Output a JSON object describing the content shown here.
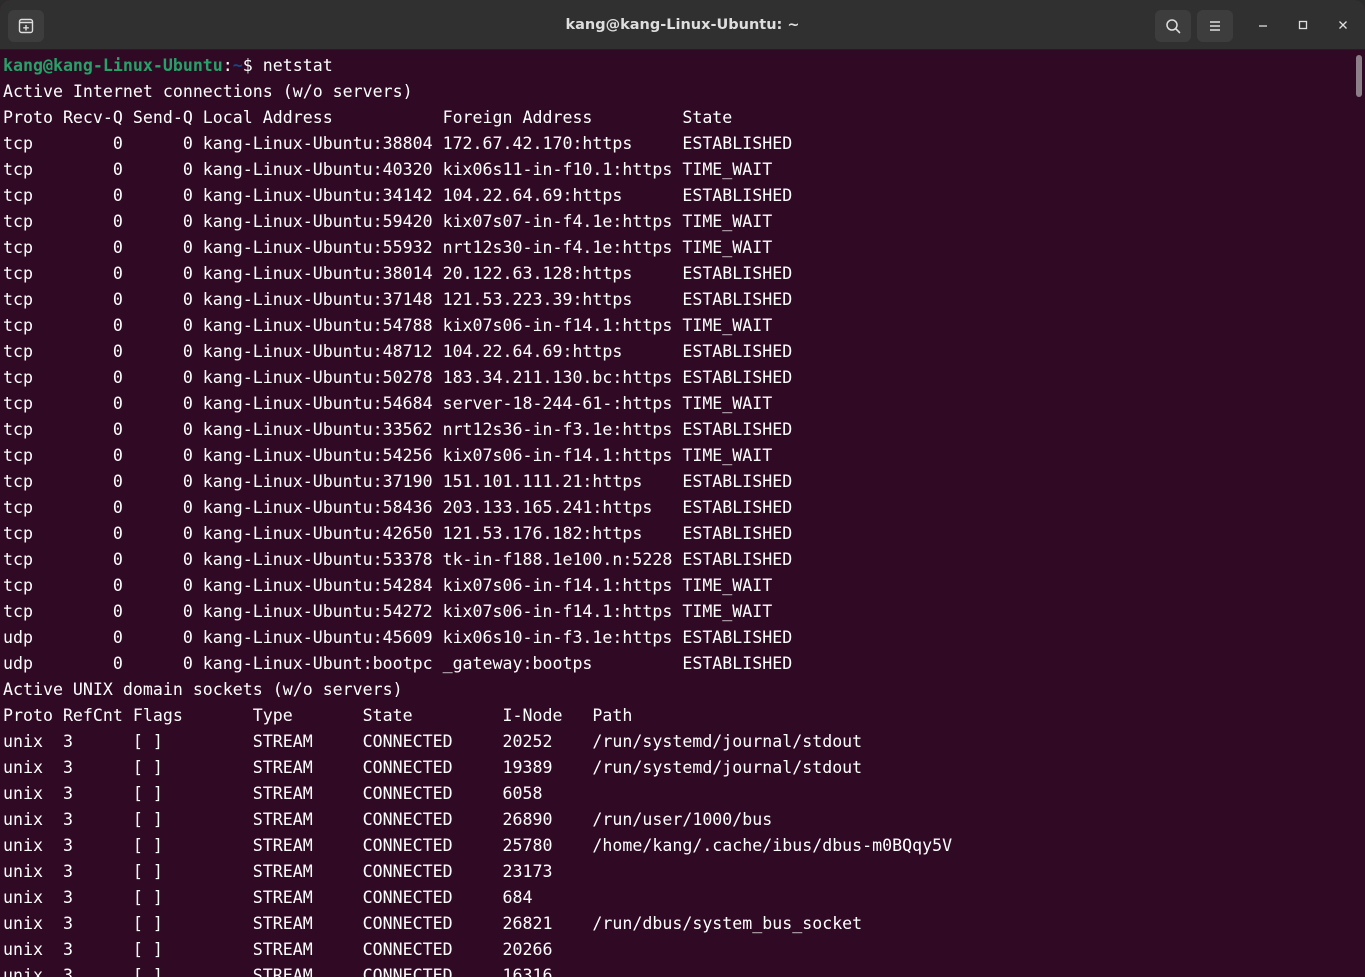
{
  "window": {
    "title": "kang@kang-Linux-Ubuntu: ~"
  },
  "icons": {
    "new_tab": "new-tab-icon",
    "search": "search-icon",
    "menu": "hamburger-menu-icon",
    "minimize": "minimize-icon",
    "maximize": "maximize-icon",
    "close": "close-icon"
  },
  "colors": {
    "terminal_bg": "#300a24",
    "prompt_user": "#26a269",
    "prompt_path": "#12488b",
    "titlebar_bg": "#303030"
  },
  "prompt": {
    "user_host": "kang@kang-Linux-Ubuntu",
    "separator": ":",
    "path": "~",
    "symbol": "$ ",
    "command": "netstat"
  },
  "output": {
    "inet_header": "Active Internet connections (w/o servers)",
    "inet_columns": "Proto Recv-Q Send-Q Local Address           Foreign Address         State      ",
    "inet_rows": [
      "tcp        0      0 kang-Linux-Ubuntu:38804 172.67.42.170:https     ESTABLISHED",
      "tcp        0      0 kang-Linux-Ubuntu:40320 kix06s11-in-f10.1:https TIME_WAIT  ",
      "tcp        0      0 kang-Linux-Ubuntu:34142 104.22.64.69:https      ESTABLISHED",
      "tcp        0      0 kang-Linux-Ubuntu:59420 kix07s07-in-f4.1e:https TIME_WAIT  ",
      "tcp        0      0 kang-Linux-Ubuntu:55932 nrt12s30-in-f4.1e:https TIME_WAIT  ",
      "tcp        0      0 kang-Linux-Ubuntu:38014 20.122.63.128:https     ESTABLISHED",
      "tcp        0      0 kang-Linux-Ubuntu:37148 121.53.223.39:https     ESTABLISHED",
      "tcp        0      0 kang-Linux-Ubuntu:54788 kix07s06-in-f14.1:https TIME_WAIT  ",
      "tcp        0      0 kang-Linux-Ubuntu:48712 104.22.64.69:https      ESTABLISHED",
      "tcp        0      0 kang-Linux-Ubuntu:50278 183.34.211.130.bc:https ESTABLISHED",
      "tcp        0      0 kang-Linux-Ubuntu:54684 server-18-244-61-:https TIME_WAIT  ",
      "tcp        0      0 kang-Linux-Ubuntu:33562 nrt12s36-in-f3.1e:https ESTABLISHED",
      "tcp        0      0 kang-Linux-Ubuntu:54256 kix07s06-in-f14.1:https TIME_WAIT  ",
      "tcp        0      0 kang-Linux-Ubuntu:37190 151.101.111.21:https    ESTABLISHED",
      "tcp        0      0 kang-Linux-Ubuntu:58436 203.133.165.241:https   ESTABLISHED",
      "tcp        0      0 kang-Linux-Ubuntu:42650 121.53.176.182:https    ESTABLISHED",
      "tcp        0      0 kang-Linux-Ubuntu:53378 tk-in-f188.1e100.n:5228 ESTABLISHED",
      "tcp        0      0 kang-Linux-Ubuntu:54284 kix07s06-in-f14.1:https TIME_WAIT  ",
      "tcp        0      0 kang-Linux-Ubuntu:54272 kix07s06-in-f14.1:https TIME_WAIT  ",
      "udp        0      0 kang-Linux-Ubuntu:45609 kix06s10-in-f3.1e:https ESTABLISHED",
      "udp        0      0 kang-Linux-Ubunt:bootpc _gateway:bootps         ESTABLISHED"
    ],
    "unix_header": "Active UNIX domain sockets (w/o servers)",
    "unix_columns": "Proto RefCnt Flags       Type       State         I-Node   Path",
    "unix_rows": [
      "unix  3      [ ]         STREAM     CONNECTED     20252    /run/systemd/journal/stdout",
      "unix  3      [ ]         STREAM     CONNECTED     19389    /run/systemd/journal/stdout",
      "unix  3      [ ]         STREAM     CONNECTED     6058     ",
      "unix  3      [ ]         STREAM     CONNECTED     26890    /run/user/1000/bus",
      "unix  3      [ ]         STREAM     CONNECTED     25780    /home/kang/.cache/ibus/dbus-m0BQqy5V",
      "unix  3      [ ]         STREAM     CONNECTED     23173    ",
      "unix  3      [ ]         STREAM     CONNECTED     684      ",
      "unix  3      [ ]         STREAM     CONNECTED     26821    /run/dbus/system_bus_socket",
      "unix  3      [ ]         STREAM     CONNECTED     20266    ",
      "unix  3      [ ]         STREAM     CONNECTED     16316    "
    ]
  }
}
